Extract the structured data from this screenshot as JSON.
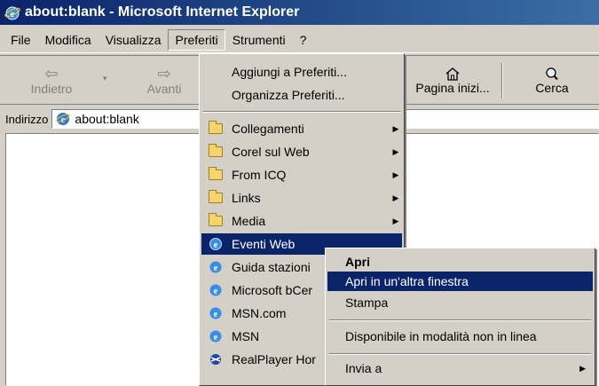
{
  "window": {
    "title": "about:blank - Microsoft Internet Explorer"
  },
  "menubar": {
    "items": [
      {
        "label": "File"
      },
      {
        "label": "Modifica"
      },
      {
        "label": "Visualizza"
      },
      {
        "label": "Preferiti"
      },
      {
        "label": "Strumenti"
      },
      {
        "label": "?"
      }
    ]
  },
  "toolbar": {
    "back_label": "Indietro",
    "forward_label": "Avanti",
    "home_label": "Pagina inizi...",
    "search_label": "Cerca"
  },
  "address": {
    "label": "Indirizzo",
    "value": "about:blank"
  },
  "favorites_menu": {
    "actions": [
      {
        "label": "Aggiungi a Preferiti..."
      },
      {
        "label": "Organizza Preferiti..."
      }
    ],
    "folders": [
      {
        "label": "Collegamenti"
      },
      {
        "label": "Corel sul Web"
      },
      {
        "label": "From ICQ"
      },
      {
        "label": "Links"
      },
      {
        "label": "Media"
      }
    ],
    "links": [
      {
        "label": "Eventi Web"
      },
      {
        "label": "Guida stazioni"
      },
      {
        "label": "Microsoft bCer"
      },
      {
        "label": "MSN.com"
      },
      {
        "label": "MSN"
      },
      {
        "label": "RealPlayer Hor"
      }
    ]
  },
  "context_menu": {
    "items": [
      {
        "label": "Apri"
      },
      {
        "label": "Apri in un'altra finestra"
      },
      {
        "label": "Stampa"
      },
      {
        "label": "Disponibile in modalità non in linea"
      },
      {
        "label": "Invia a"
      }
    ]
  },
  "colors": {
    "selection": "#0a246a",
    "titlebar_start": "#0a246a",
    "titlebar_end": "#3a6ea5",
    "face": "#d4d0c8"
  }
}
